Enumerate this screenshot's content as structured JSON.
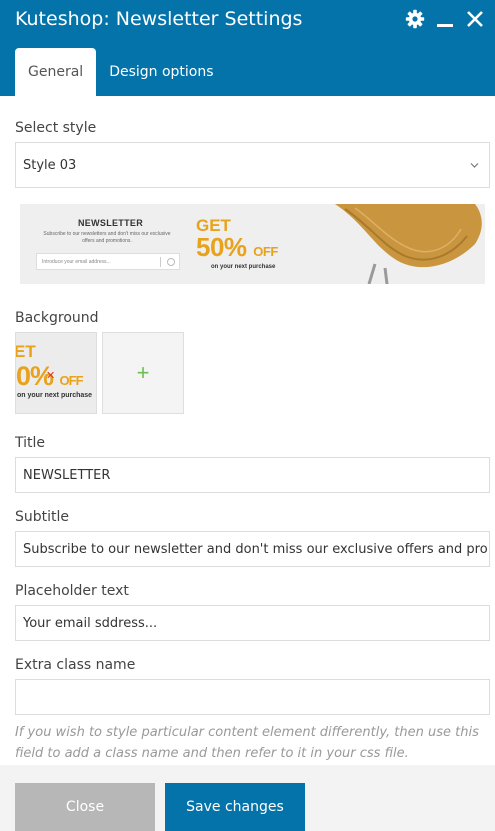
{
  "window": {
    "title": "Kuteshop: Newsletter Settings",
    "icons": [
      "gear-icon",
      "minimize-icon",
      "close-icon"
    ]
  },
  "tabs": [
    {
      "label": "General",
      "active": true
    },
    {
      "label": "Design options",
      "active": false
    }
  ],
  "form": {
    "select_style": {
      "label": "Select style",
      "value": "Style 03"
    },
    "preview": {
      "heading": "NEWSLETTER",
      "subtext": "Subscribe to our newsletters and don't miss our exclusive offers and promotions.",
      "input_placeholder": "Introduce your email address...",
      "get": "GET",
      "percent": "50%",
      "off": "OFF",
      "next": "on your next purchase"
    },
    "background": {
      "label": "Background",
      "thumb_line1": "ET",
      "thumb_line2": "0%",
      "thumb_off": "OFF",
      "thumb_line3": "on your next purchase",
      "add_symbol": "+"
    },
    "title": {
      "label": "Title",
      "value": "NEWSLETTER"
    },
    "subtitle": {
      "label": "Subtitle",
      "value": "Subscribe to our newsletter and don't miss our exclusive offers and pro"
    },
    "placeholder_text": {
      "label": "Placeholder text",
      "value": "Your email sddress..."
    },
    "extra_class": {
      "label": "Extra class name",
      "value": ""
    },
    "help_text": "If you wish to style particular content element differently, then use this field to add a class name and then refer to it in your css file."
  },
  "footer": {
    "close_label": "Close",
    "save_label": "Save changes"
  },
  "colors": {
    "header_bg": "#0473aa",
    "accent_gold": "#e8a21c",
    "add_green": "#6dbf52",
    "close_btn": "#b7b7b7"
  }
}
